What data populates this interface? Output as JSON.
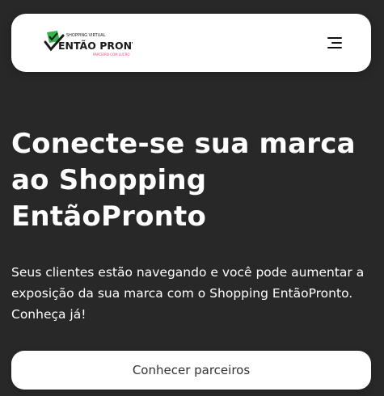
{
  "header": {
    "logo": {
      "top_text": "SHOPPING VIRTUAL",
      "brand_text": "ENTÃO PRONTO",
      "tagline": "PARCEIRO COM LUCRO",
      "colors": {
        "accent_green": "#37b24d",
        "dark": "#1a1a1a",
        "pink": "#e64980"
      },
      "icon": "check-bag-icon"
    },
    "menu_icon": "hamburger-menu-icon"
  },
  "hero": {
    "title": "Conecte-se sua marca ao Shopping EntãoPronto",
    "description": "Seus clientes estão navegando e você pode aumentar a exposição da sua marca com o Shopping EntãoPronto. Conheça já!",
    "cta_label": "Conhecer parceiros"
  },
  "colors": {
    "background": "#282828",
    "card": "#ffffff",
    "text_light": "#ffffff",
    "button_text": "#333333"
  }
}
